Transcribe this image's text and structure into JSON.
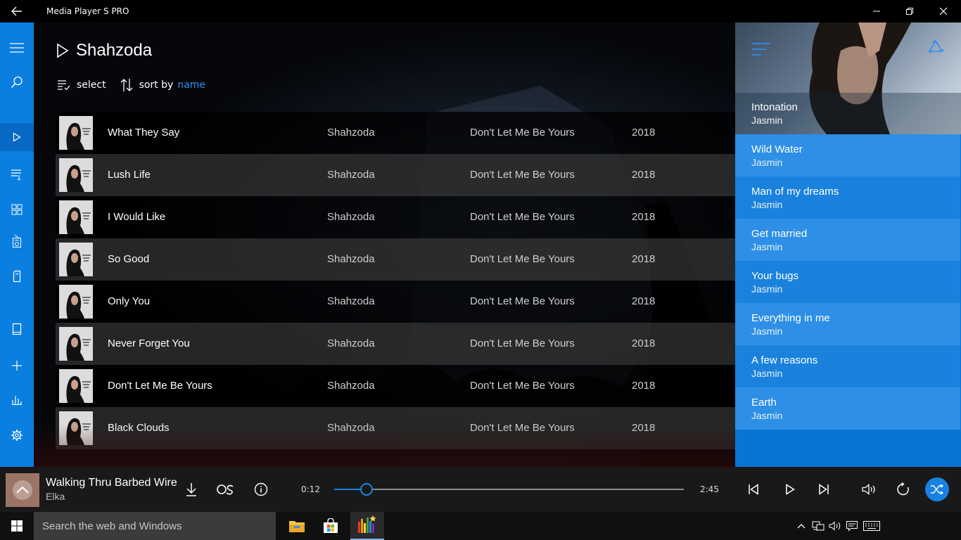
{
  "window": {
    "title": "Media Player S PRO"
  },
  "page": {
    "title": "Shahzoda"
  },
  "toolbar": {
    "select_label": "select",
    "sort_label": "sort by",
    "sort_value": "name"
  },
  "tracks": [
    {
      "title": "What They Say",
      "artist": "Shahzoda",
      "album": "Don't Let Me Be Yours",
      "year": "2018"
    },
    {
      "title": "Lush Life",
      "artist": "Shahzoda",
      "album": "Don't Let Me Be Yours",
      "year": "2018"
    },
    {
      "title": "I Would Like",
      "artist": "Shahzoda",
      "album": "Don't Let Me Be Yours",
      "year": "2018"
    },
    {
      "title": "So Good",
      "artist": "Shahzoda",
      "album": "Don't Let Me Be Yours",
      "year": "2018"
    },
    {
      "title": "Only You",
      "artist": "Shahzoda",
      "album": "Don't Let Me Be Yours",
      "year": "2018"
    },
    {
      "title": "Never Forget You",
      "artist": "Shahzoda",
      "album": "Don't Let Me Be Yours",
      "year": "2018"
    },
    {
      "title": "Don't Let Me Be Yours",
      "artist": "Shahzoda",
      "album": "Don't Let Me Be Yours",
      "year": "2018"
    },
    {
      "title": "Black Clouds",
      "artist": "Shahzoda",
      "album": "Don't Let Me Be Yours",
      "year": "2018"
    }
  ],
  "queue": {
    "current": {
      "title": "Intonation",
      "artist": "Jasmin"
    },
    "items": [
      {
        "title": "Wild Water",
        "artist": "Jasmin"
      },
      {
        "title": "Man of my dreams",
        "artist": "Jasmin"
      },
      {
        "title": "Get married",
        "artist": "Jasmin"
      },
      {
        "title": "Your bugs",
        "artist": "Jasmin"
      },
      {
        "title": "Everything in me",
        "artist": "Jasmin"
      },
      {
        "title": "A few reasons",
        "artist": "Jasmin"
      },
      {
        "title": "Earth",
        "artist": "Jasmin"
      }
    ]
  },
  "player": {
    "now_playing": {
      "title": "Walking Thru Barbed Wire",
      "artist": "Elka"
    },
    "current_time": "0:12",
    "total_time": "2:45",
    "progress": 0.093,
    "shuffle_on": true
  },
  "taskbar": {
    "search_placeholder": "Search the web and Windows"
  },
  "icons": {
    "rail": [
      "hamburger-icon",
      "search-icon",
      "play-icon",
      "playlist-icon",
      "grid-icon",
      "radio-icon",
      "device-icon",
      "tablet-icon",
      "add-icon",
      "equalizer-icon",
      "settings-icon"
    ]
  },
  "colors": {
    "accent": "#1683e3",
    "rail": "#0a7fe0",
    "queue": "#0a74d4",
    "link": "#2d8fef"
  }
}
